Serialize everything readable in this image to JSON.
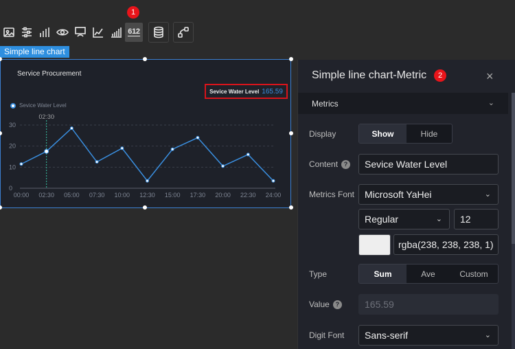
{
  "toolbar": {
    "badge": "1",
    "icons": [
      "image-icon",
      "sliders-icon",
      "bar-chart-icon",
      "eye-target-icon",
      "monitor-icon",
      "line-chart-icon",
      "column-chart-icon",
      "counter-icon",
      "database-icon",
      "data-flow-icon"
    ],
    "counter_label": "612"
  },
  "chart": {
    "tag": "Simple line chart",
    "title": "Service Procurement",
    "metric_label": "Sevice Water Level",
    "metric_value": "165.59",
    "legend": "Sevice Water Level",
    "tooltip": "02:30",
    "accent": "#3a8fe0"
  },
  "chart_data": {
    "type": "line",
    "title": "Service Procurement",
    "xlabel": "",
    "ylabel": "",
    "ylim": [
      0,
      30
    ],
    "yticks": [
      "0",
      "10",
      "20",
      "30"
    ],
    "categories": [
      "00:00",
      "02:30",
      "05:00",
      "07:30",
      "10:00",
      "12:30",
      "15:00",
      "17:30",
      "20:00",
      "22:30",
      "24:00"
    ],
    "series": [
      {
        "name": "Sevice Water Level",
        "values": [
          11.5,
          17.5,
          28.5,
          12.5,
          19,
          3.5,
          18.5,
          24,
          10.5,
          16,
          3.5
        ]
      }
    ],
    "grid": true,
    "legend_position": "top-left"
  },
  "panel": {
    "badge": "2",
    "title": "Simple line chart-Metric",
    "close": "×",
    "section": "Metrics",
    "display_label": "Display",
    "display_options": [
      "Show",
      "Hide"
    ],
    "display_selected": "Show",
    "content_label": "Content",
    "content_value": "Sevice Water Level",
    "metrics_font_label": "Metrics Font",
    "font_family": "Microsoft YaHei",
    "font_weight": "Regular",
    "font_size": "12",
    "color_value": "rgba(238, 238, 238, 1)",
    "type_label": "Type",
    "type_options": [
      "Sum",
      "Ave",
      "Custom"
    ],
    "type_selected": "Sum",
    "value_label": "Value",
    "value_value": "165.59",
    "digit_font_label": "Digit Font",
    "digit_font_value": "Sans-serif"
  }
}
